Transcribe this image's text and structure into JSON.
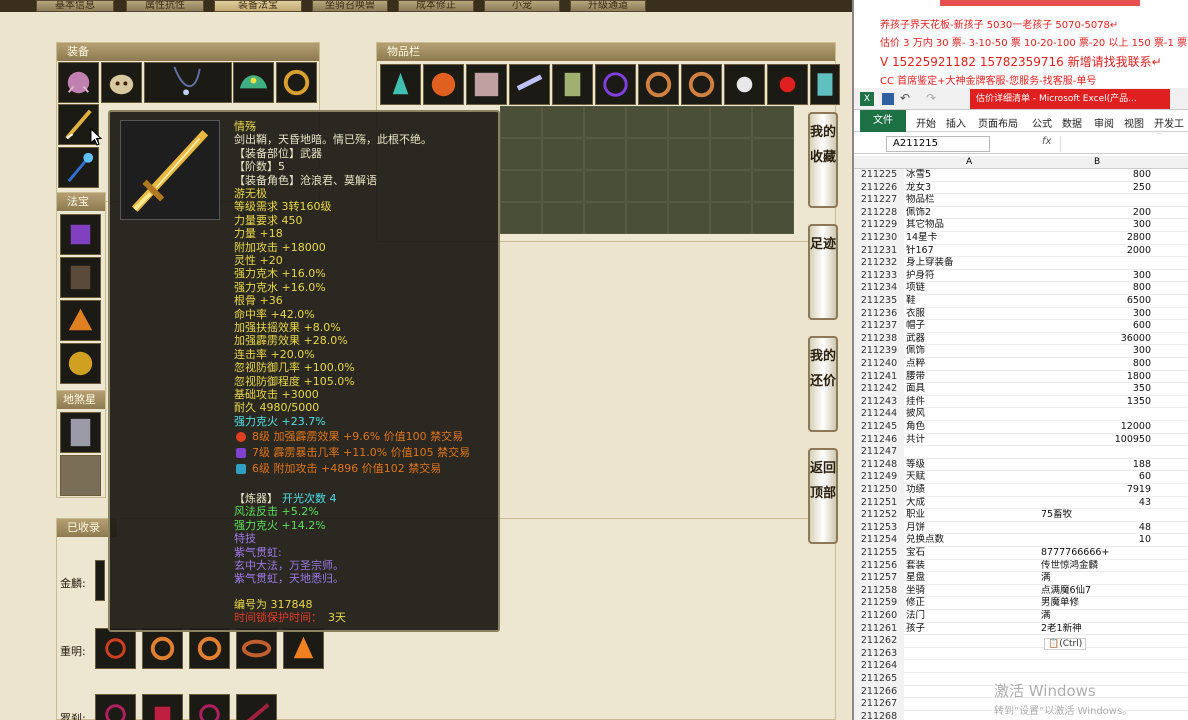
{
  "game": {
    "tabs": [
      "基本信息",
      "属性抗性",
      "装备法宝",
      "坐骑召唤兽",
      "成本修正",
      "小宠",
      "升级通道"
    ],
    "equip_panel_title": "装备",
    "fabao_panel_title": "法宝",
    "dipan_panel_title": "地煞星盘",
    "bag_panel_title": "物品栏",
    "collection_panel_title": "已收录",
    "collection_rows": [
      "金麟:",
      "重明:",
      "罗刹:"
    ],
    "side_buttons": [
      "我的收藏",
      "足迹",
      "我的还价",
      "返回顶部"
    ]
  },
  "tooltip": {
    "name": "情殇",
    "desc": "剑出鞘，天昏地暗。情已殇，此根不绝。",
    "slot": "【装备部位】武器",
    "rank": "【阶数】5",
    "role": "【装备角色】沧浪君、莫解语",
    "owner": "游无极",
    "level": "等级需求 3转160级",
    "str_req": "力量要求 450",
    "stats": [
      "力量 +18",
      "附加攻击 +18000",
      "灵性 +20",
      "强力克木 +16.0%",
      "强力克水 +16.0%",
      "根骨 +36",
      "命中率 +42.0%",
      "加强扶摇效果 +8.0%",
      "加强霹雳效果 +28.0%",
      "连击率 +20.0%",
      "忽视防御几率 +100.0%",
      "忽视防御程度 +105.0%",
      "基础攻击 +3000",
      "耐久 4980/5000"
    ],
    "highlight": "强力克火 +23.7%",
    "gems": [
      "8级 加强霹雳效果 +9.6% 价值100 禁交易",
      "7级 霹雳暴击几率 +11.0% 价值105 禁交易",
      "6级 附加攻击 +4896 价值102 禁交易"
    ],
    "refine_label": "【炼器】",
    "refine_value": "开光次数 4",
    "refine_stats": [
      "风法反击 +5.2%",
      "强力克火 +14.2%"
    ],
    "skill_title": "特技",
    "skill_name": "紫气贯虹:",
    "skill_lines": [
      "玄中大法，万圣宗师。",
      "紫气贯虹，天地悉归。"
    ],
    "serial": "编号为 317848",
    "protect_label": "时间锁保护时间：",
    "protect_value": "3天"
  },
  "excel": {
    "banner_lines": [
      "养孩子界天花板-新孩子 5030一老孩子 5070-5078↵",
      "估价 3 万内 30 票- 3-10-50 票 10-20-100 票-20 以上 150 票-1 票 1",
      "V 15225921182  15782359716  新增请找我联系↵",
      "CC 首席鉴定+大神金牌客服-您服务-找客服-单号"
    ],
    "window_title": "估价详细清单 - Microsoft Excel(产品...",
    "ribbon_tabs": [
      "文件",
      "开始",
      "插入",
      "页面布局",
      "公式",
      "数据",
      "审阅",
      "视图",
      "开发工具"
    ],
    "name_box": "A211215",
    "fx": "fx",
    "col_headers": [
      "A",
      "B"
    ],
    "rows": [
      {
        "n": "211225",
        "a": "冰雪5",
        "b": "800"
      },
      {
        "n": "211226",
        "a": "龙女3",
        "b": "250"
      },
      {
        "n": "211227",
        "a": "物品栏",
        "b": ""
      },
      {
        "n": "211228",
        "a": "佩饰2",
        "b": "200"
      },
      {
        "n": "211229",
        "a": "其它物品",
        "b": "300"
      },
      {
        "n": "211230",
        "a": "14星卡",
        "b": "2800"
      },
      {
        "n": "211231",
        "a": "针167",
        "b": "2000"
      },
      {
        "n": "211232",
        "a": "身上穿装备",
        "b": ""
      },
      {
        "n": "211233",
        "a": "护身符",
        "b": "300"
      },
      {
        "n": "211234",
        "a": "项链",
        "b": "800"
      },
      {
        "n": "211235",
        "a": "鞋",
        "b": "6500"
      },
      {
        "n": "211236",
        "a": "衣服",
        "b": "300"
      },
      {
        "n": "211237",
        "a": "帽子",
        "b": "600"
      },
      {
        "n": "211238",
        "a": "武器",
        "b": "36000"
      },
      {
        "n": "211239",
        "a": "佩饰",
        "b": "300"
      },
      {
        "n": "211240",
        "a": "点粹",
        "b": "800"
      },
      {
        "n": "211241",
        "a": "腰带",
        "b": "1800"
      },
      {
        "n": "211242",
        "a": "面具",
        "b": "350"
      },
      {
        "n": "211243",
        "a": "挂件",
        "b": "1350"
      },
      {
        "n": "211244",
        "a": "披风",
        "b": ""
      },
      {
        "n": "211245",
        "a": "角色",
        "b": "12000"
      },
      {
        "n": "211246",
        "a": "共计",
        "b": "100950"
      },
      {
        "n": "211247",
        "a": "",
        "b": ""
      },
      {
        "n": "211248",
        "a": "等级",
        "b": "188"
      },
      {
        "n": "211249",
        "a": "天赋",
        "b": "60"
      },
      {
        "n": "211250",
        "a": "功绩",
        "b": "7919"
      },
      {
        "n": "211251",
        "a": "大成",
        "b": "43"
      },
      {
        "n": "211252",
        "a": "职业",
        "b": "75畜牧"
      },
      {
        "n": "211253",
        "a": "月饼",
        "b": "48"
      },
      {
        "n": "211254",
        "a": "兑换点数",
        "b": "10"
      },
      {
        "n": "211255",
        "a": "宝石",
        "b": "8777766666+"
      },
      {
        "n": "211256",
        "a": "套装",
        "b": "传世惊鸿金麟"
      },
      {
        "n": "211257",
        "a": "星盘",
        "b": "满"
      },
      {
        "n": "211258",
        "a": "坐骑",
        "b": "点满魔6仙7"
      },
      {
        "n": "211259",
        "a": "修正",
        "b": "男魔单修"
      },
      {
        "n": "211260",
        "a": "法门",
        "b": "满"
      },
      {
        "n": "211261",
        "a": "孩子",
        "b": "2老1新神"
      },
      {
        "n": "211262",
        "a": "",
        "b": ""
      },
      {
        "n": "211263",
        "a": "",
        "b": ""
      },
      {
        "n": "211264",
        "a": "",
        "b": ""
      },
      {
        "n": "211265",
        "a": "",
        "b": ""
      },
      {
        "n": "211266",
        "a": "",
        "b": ""
      },
      {
        "n": "211267",
        "a": "",
        "b": ""
      },
      {
        "n": "211268",
        "a": "",
        "b": ""
      }
    ],
    "paste_hint": "(Ctrl)",
    "watermark_1": "激活 Windows",
    "watermark_2": "转到“设置”以激活 Windows。"
  }
}
